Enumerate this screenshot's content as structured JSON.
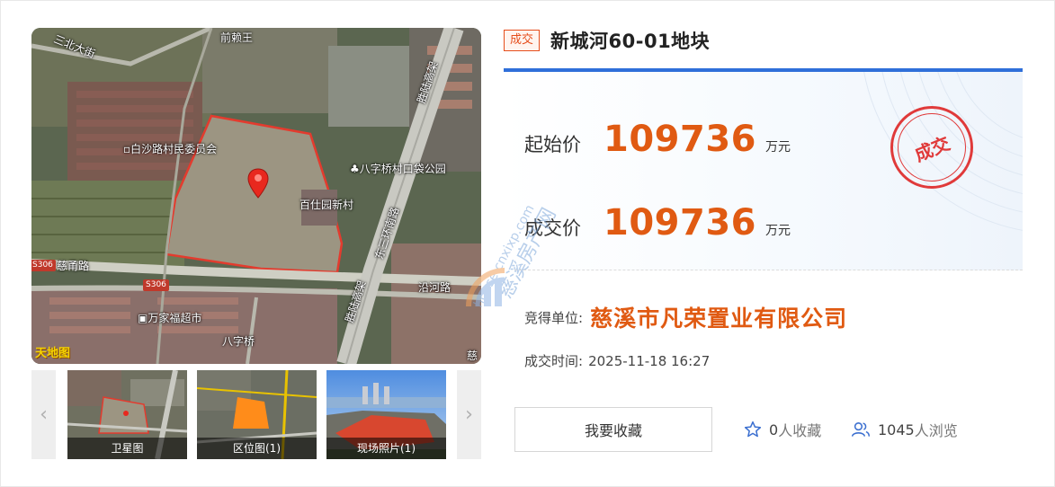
{
  "map": {
    "labels": {
      "north_road": "前赖王",
      "northwest_road": "三北大街",
      "village_committee": "白沙路村民委员会",
      "park": "八字桥村口袋公园",
      "new_village": "百仕园新村",
      "elevated_road_top": "胜陆高架",
      "east_ring": "东三环南路",
      "cier_road": "慈甬路",
      "yanhe_road": "沿河路",
      "elevated_road_bottom": "胜陆高架",
      "market": "万家福超市",
      "bazi_bridge": "八字桥",
      "cixi_edge": "慈"
    },
    "road_badges": [
      "S306",
      "S306"
    ],
    "logo": "天地图"
  },
  "thumbs": [
    {
      "caption": "卫星图"
    },
    {
      "caption": "区位图(1)"
    },
    {
      "caption": "现场照片(1)"
    }
  ],
  "nav": {
    "prev": "‹",
    "next": "›"
  },
  "header": {
    "status_tag": "成交",
    "title": "新城河60-01地块"
  },
  "prices": {
    "start_label": "起始价",
    "start_value": "109736",
    "start_unit": "万元",
    "deal_label": "成交价",
    "deal_value": "109736",
    "deal_unit": "万元",
    "stamp": "成交"
  },
  "watermark": {
    "url": "house.cnxixp.com",
    "name": "慈溪房产网"
  },
  "info": {
    "winner_label": "竞得单位:",
    "winner_value": "慈溪市凡荣置业有限公司",
    "time_label": "成交时间:",
    "time_value": "2025-11-18 16:27"
  },
  "actions": {
    "favorite_button": "我要收藏",
    "fav_count": "0",
    "fav_unit": "人收藏",
    "view_count": "1045",
    "view_unit": "人浏览"
  },
  "colors": {
    "accent_blue": "#2f6fd9",
    "price_orange": "#e05a12",
    "stamp_red": "#e03a3a"
  }
}
